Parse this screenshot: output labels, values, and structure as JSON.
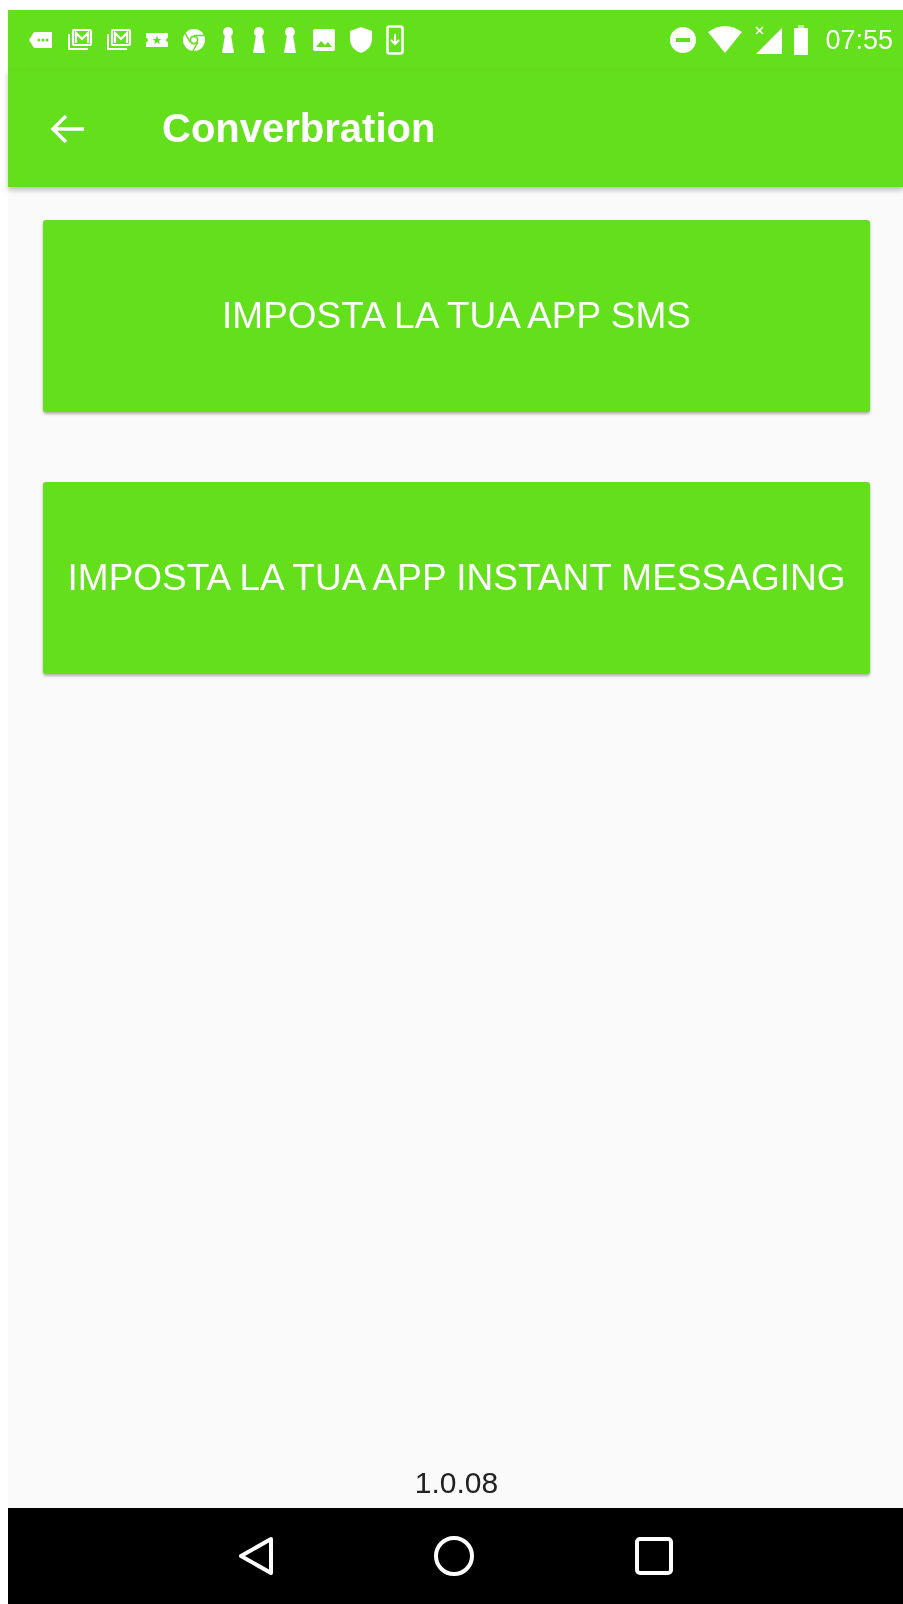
{
  "status_bar": {
    "time": "07:55"
  },
  "app_bar": {
    "title": "Converbration"
  },
  "buttons": [
    {
      "label": "IMPOSTA LA TUA APP SMS"
    },
    {
      "label": "IMPOSTA LA TUA APP INSTANT MESSAGING"
    }
  ],
  "footer": {
    "version": "1.0.08"
  }
}
